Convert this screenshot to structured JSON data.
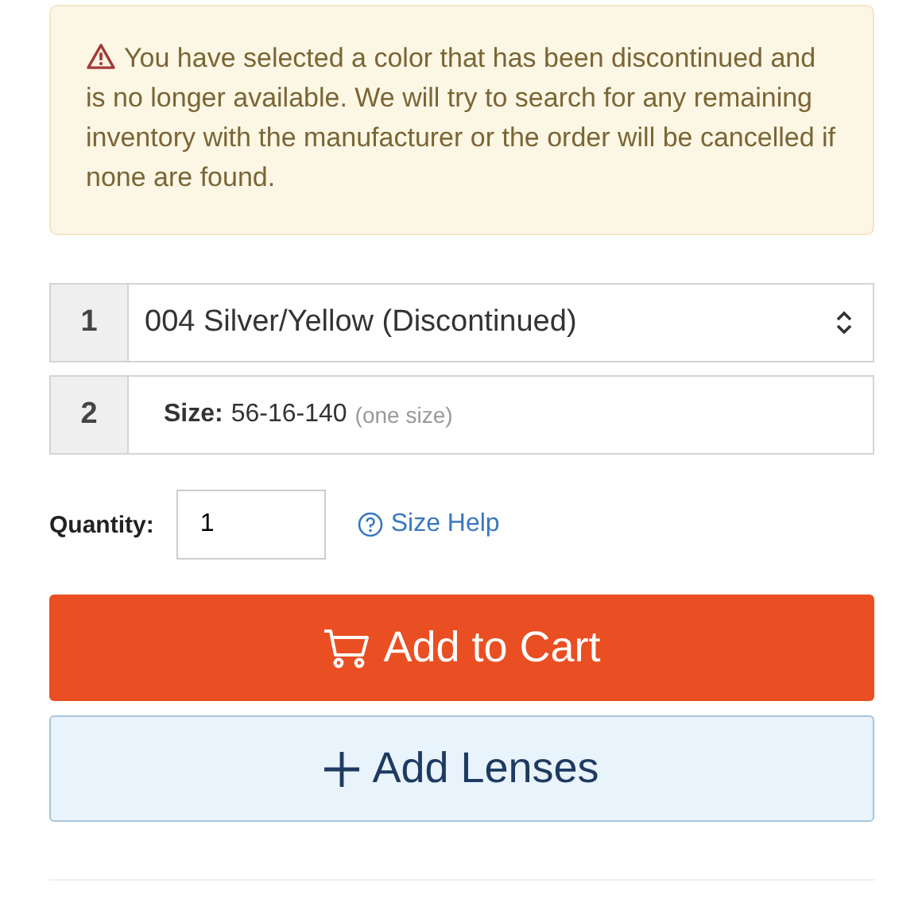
{
  "alert": {
    "kind": "warning",
    "message": "You have selected a color that has been discontinued and is no longer available. We will try to search for any remaining inventory with the manufacturer or the order will be cancelled if none are found."
  },
  "options": [
    {
      "kind": "select",
      "step": "1",
      "value": "004 Silver/Yellow (Discontinued)"
    },
    {
      "kind": "info",
      "step": "2",
      "label": "Size:",
      "value": "56-16-140",
      "note": "(one size)"
    }
  ],
  "quantity": {
    "label": "Quantity:",
    "value": "1"
  },
  "size_help": "Size Help",
  "buttons": [
    {
      "kind": "cart",
      "label": "Add to Cart"
    },
    {
      "kind": "lenses",
      "label": "Add Lenses"
    }
  ]
}
